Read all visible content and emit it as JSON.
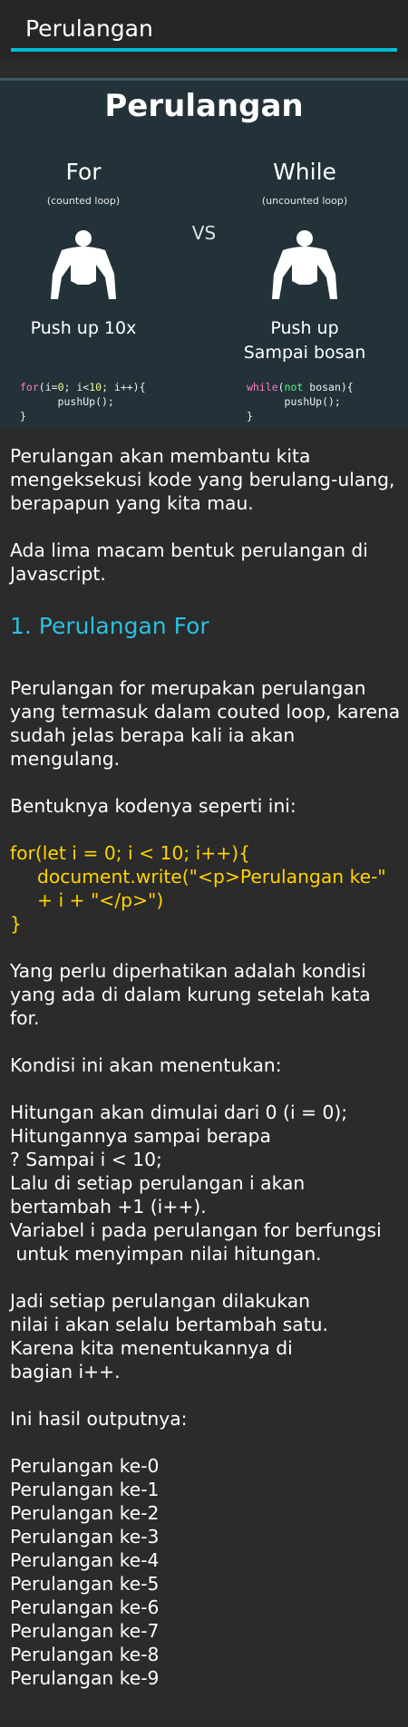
{
  "appbar": {
    "title": "Perulangan"
  },
  "hero": {
    "title": "Perulangan",
    "vs": "VS",
    "left": {
      "title": "For",
      "subtitle": "(counted loop)",
      "push_label": "Push up 10x",
      "code": [
        "for",
        "(i=",
        "0",
        "; i<",
        "10",
        "; i++){",
        "pushUp();",
        "}"
      ]
    },
    "right": {
      "title": "While",
      "subtitle": "(uncounted loop)",
      "push_label_1": "Push up",
      "push_label_2": "Sampai bosan",
      "code": [
        "while",
        "(",
        "not",
        " bosan){",
        "pushUp();",
        "}"
      ]
    }
  },
  "content": {
    "intro": "Perulangan akan membantu kita mengeksekusi kode yang berulang-ulang, berapapun yang kita mau.",
    "intro2": "Ada lima macam bentuk perulangan di Javascript.",
    "heading_for": "1. Perulangan For",
    "for_desc": "Perulangan for merupakan perulangan yang termasuk dalam couted loop, karena sudah jelas berapa kali ia akan mengulang.",
    "bentuk": "Bentuknya kodenya seperti ini:",
    "code_line1": "for(let i = 0; i < 10; i++){",
    "code_line2": "document.write(\"<p>Perulangan ke-\" + i + \"</p>\")",
    "code_line3": "}",
    "perhatikan": "Yang perlu diperhatikan adalah kondisi yang ada di dalam kurung setelah kata for.",
    "kondisi": "Kondisi ini akan menentukan:",
    "rules": [
      "Hitungan akan dimulai dari 0 (i = 0);",
      "Hitungannya sampai berapa",
      "? Sampai i < 10;",
      "Lalu di setiap perulangan i akan",
      "bertambah +1 (i++).",
      "Variabel i pada perulangan for berfungsi",
      " untuk menyimpan nilai hitungan."
    ],
    "jadi": [
      "Jadi setiap perulangan dilakukan",
      "nilai i akan selalu bertambah satu.",
      "Karena kita menentukannya di",
      "bagian i++."
    ],
    "hasil": "Ini hasil outputnya:",
    "outputs": [
      "Perulangan ke-0",
      "Perulangan ke-1",
      "Perulangan ke-2",
      "Perulangan ke-3",
      "Perulangan ke-4",
      "Perulangan ke-5",
      "Perulangan ke-6",
      "Perulangan ke-7",
      "Perulangan ke-8",
      "Perulangan ke-9"
    ]
  },
  "colors": {
    "accent": "#00bcd4",
    "heading": "#29c1e0",
    "code": "#ffd400",
    "hero_bg": "#223238"
  }
}
